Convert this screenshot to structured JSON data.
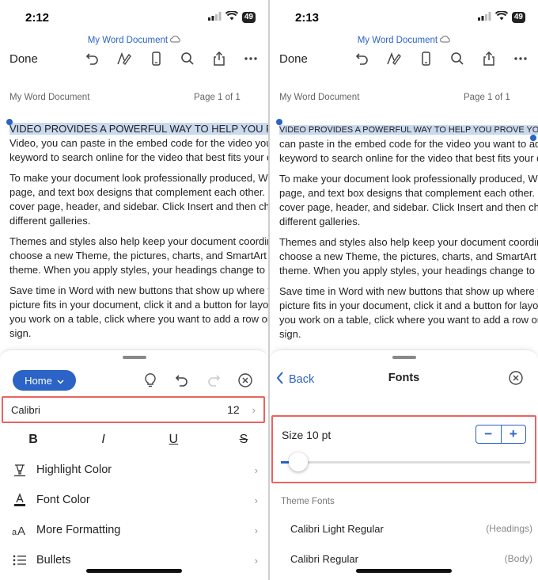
{
  "colors": {
    "accent": "#2b63c6",
    "highlight": "#e9645f",
    "selection": "#c9d9ee"
  },
  "left": {
    "status": {
      "time": "2:12",
      "battery": "49"
    },
    "doc_title": "My Word Document",
    "done_label": "Done",
    "toolbar_icons": [
      "undo-icon",
      "draw-icon",
      "phone-view-icon",
      "search-icon",
      "share-icon",
      "more-icon"
    ],
    "header": {
      "left": "My Word Document",
      "right": "Page 1 of 1"
    },
    "paragraphs": [
      [
        "VIDEO PROVIDES A POWERFUL WAY TO HELP YOU PROVE YO",
        "Video, you can paste in the embed code for the video you wa",
        "keyword to search online for the video that best fits your doc"
      ],
      [
        "To make your document look professionally produced, Word",
        "page, and text box designs that complement each other. For",
        "cover page, header, and sidebar. Click Insert and then choose",
        "different galleries."
      ],
      [
        "Themes and styles also help keep your document coordinate",
        "choose a new Theme, the pictures, charts, and SmartArt gra",
        "theme. When you apply styles, your headings change to mat"
      ],
      [
        "Save time in Word with new buttons that show up where you",
        "picture fits in your document, click it and a button for layout",
        "you work on a table, click where you want to add a row or a",
        "sign."
      ]
    ],
    "sheet": {
      "home_label": "Home",
      "font_name": "Calibri",
      "font_size": "12",
      "format_buttons": [
        "B",
        "I",
        "U",
        "S"
      ],
      "rows": [
        {
          "label": "Highlight Color",
          "icon": "highlighter-icon"
        },
        {
          "label": "Font Color",
          "icon": "font-color-icon"
        },
        {
          "label": "More Formatting",
          "icon": "more-formatting-icon"
        },
        {
          "label": "Bullets",
          "icon": "bullets-icon"
        }
      ]
    }
  },
  "right": {
    "status": {
      "time": "2:13",
      "battery": "49"
    },
    "doc_title": "My Word Document",
    "done_label": "Done",
    "header": {
      "left": "My Word Document",
      "right": "Page 1 of 1"
    },
    "paragraphs": [
      [
        "VIDEO PROVIDES A POWERFUL WAY TO HELP YOU PROVE YOUR POINT.",
        "can paste in the embed code for the video you want to add.",
        "keyword to search online for the video that best fits your document."
      ],
      [
        "To make your document look professionally produced, Word",
        "page, and text box designs that complement each other. For",
        "cover page, header, and sidebar. Click Insert and then choose",
        "different galleries."
      ],
      [
        "Themes and styles also help keep your document coordinate",
        "choose a new Theme, the pictures, charts, and SmartArt grap",
        "theme. When you apply styles, your headings change to mat"
      ],
      [
        "Save time in Word with new buttons that show up where you",
        "picture fits in your document, click it and a button for layout",
        "you work on a table, click where you want to add a row or a",
        "sign."
      ]
    ],
    "sheet": {
      "back_label": "Back",
      "title": "Fonts",
      "size_label": "Size 10 pt",
      "minus": "−",
      "plus": "+",
      "size_slider_fraction": 0.07,
      "theme_fonts_label": "Theme Fonts",
      "fonts": [
        {
          "name": "Calibri Light Regular",
          "tag": "(Headings)"
        },
        {
          "name": "Calibri Regular",
          "tag": "(Body)"
        }
      ]
    }
  }
}
